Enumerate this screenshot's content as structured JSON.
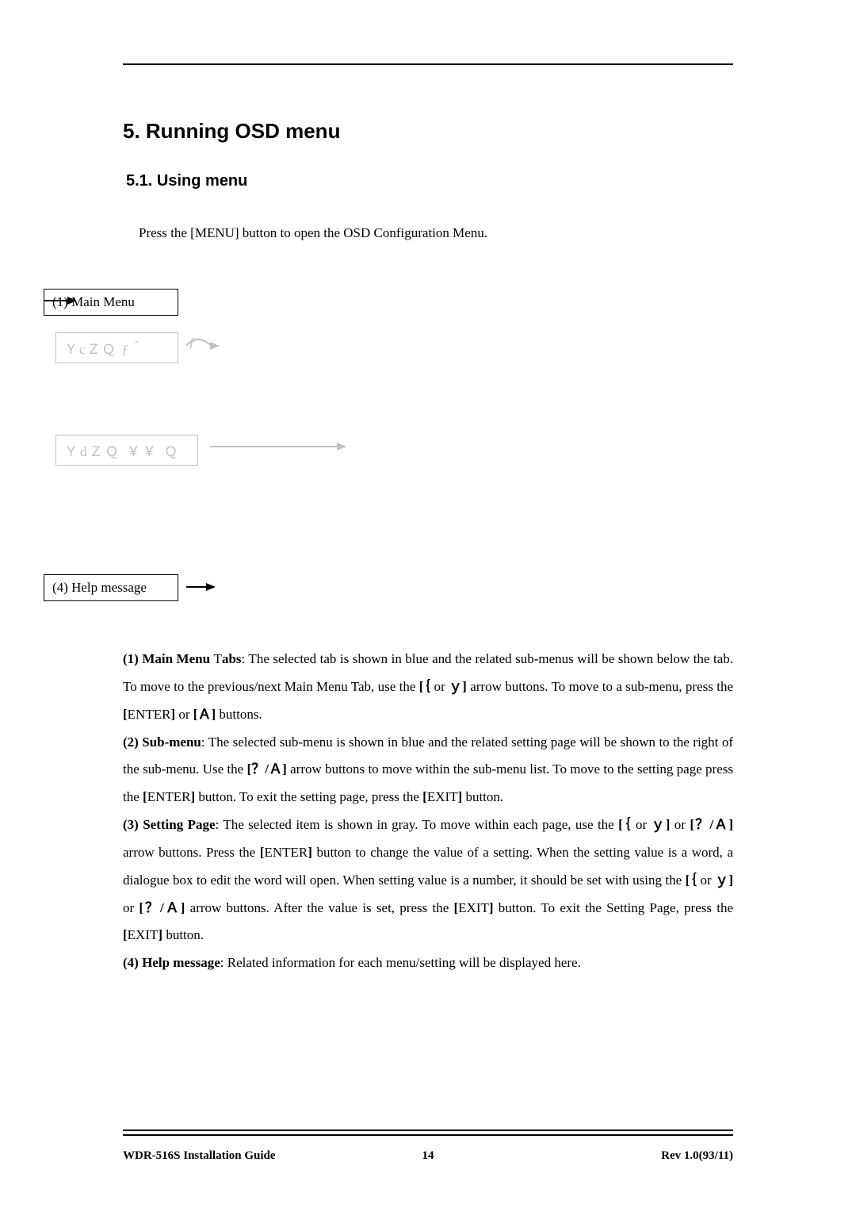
{
  "heading1": "5.  Running OSD menu",
  "heading2": "5.1.  Using menu",
  "intro": "Press the [MENU] button to open the OSD Configuration Menu.",
  "diagram": {
    "box1": "(1) Main Menu",
    "box2": "ＹcＺＱ ƒ＾",
    "box2_curve": "ƒ",
    "box3": "ＹdＺＱ ￥￥ Ｑ",
    "box4": "(4) Help message"
  },
  "paragraphs": [
    [
      {
        "bold": true,
        "text": "(1) Main Menu "
      },
      {
        "bold": false,
        "text": "T"
      },
      {
        "bold": true,
        "text": "abs"
      },
      {
        "bold": false,
        "text": ": The selected tab is shown in blue and the related sub-menus will be shown below the tab. To move to the previous/next Main Menu Tab, use the "
      },
      {
        "bold": true,
        "text": "[｛"
      },
      {
        "bold": false,
        "text": " or "
      },
      {
        "bold": true,
        "text": "ｙ]"
      },
      {
        "bold": false,
        "text": " arrow buttons. To move to a sub-menu, press the "
      },
      {
        "bold": true,
        "text": "["
      },
      {
        "bold": false,
        "text": "ENTER"
      },
      {
        "bold": true,
        "text": "]"
      },
      {
        "bold": false,
        "text": " or "
      },
      {
        "bold": true,
        "text": "[Ａ]"
      },
      {
        "bold": false,
        "text": " buttons."
      }
    ],
    [
      {
        "bold": true,
        "text": "(2) Sub-menu"
      },
      {
        "bold": false,
        "text": ": The selected sub-menu is shown in blue and the related setting page will be shown to the right of the sub-menu. Use the "
      },
      {
        "bold": true,
        "text": "[？/Ａ]"
      },
      {
        "bold": false,
        "text": " arrow buttons to move within the sub-menu list. To move to the setting page press the "
      },
      {
        "bold": true,
        "text": "["
      },
      {
        "bold": false,
        "text": "ENTER"
      },
      {
        "bold": true,
        "text": "]"
      },
      {
        "bold": false,
        "text": " button. To exit the setting page, press the "
      },
      {
        "bold": true,
        "text": "["
      },
      {
        "bold": false,
        "text": "EXIT"
      },
      {
        "bold": true,
        "text": "]"
      },
      {
        "bold": false,
        "text": " button."
      }
    ],
    [
      {
        "bold": true,
        "text": "(3) Setting Page"
      },
      {
        "bold": false,
        "text": ": The selected item is shown in gray. To move within each page, use the "
      },
      {
        "bold": true,
        "text": "[｛"
      },
      {
        "bold": false,
        "text": " or "
      },
      {
        "bold": true,
        "text": "ｙ]"
      },
      {
        "bold": false,
        "text": " or "
      },
      {
        "bold": true,
        "text": "[？/Ａ]"
      },
      {
        "bold": false,
        "text": " arrow buttons. Press the "
      },
      {
        "bold": true,
        "text": "["
      },
      {
        "bold": false,
        "text": "ENTER"
      },
      {
        "bold": true,
        "text": "]"
      },
      {
        "bold": false,
        "text": " button to change the value of a setting. When the setting value is a word, a dialogue box to edit the word will open. When setting value is a number, it should be set with using the "
      },
      {
        "bold": true,
        "text": "[｛"
      },
      {
        "bold": false,
        "text": " or "
      },
      {
        "bold": true,
        "text": "ｙ]"
      },
      {
        "bold": false,
        "text": " or "
      },
      {
        "bold": true,
        "text": "[？/Ａ]"
      },
      {
        "bold": false,
        "text": " arrow buttons. After the value is set, press the "
      },
      {
        "bold": true,
        "text": "["
      },
      {
        "bold": false,
        "text": "EXIT"
      },
      {
        "bold": true,
        "text": "]"
      },
      {
        "bold": false,
        "text": " button. To exit the Setting Page, press the "
      },
      {
        "bold": true,
        "text": "["
      },
      {
        "bold": false,
        "text": "EXIT"
      },
      {
        "bold": true,
        "text": "]"
      },
      {
        "bold": false,
        "text": " button."
      }
    ],
    [
      {
        "bold": true,
        "text": "(4) Help message"
      },
      {
        "bold": false,
        "text": ": Related information for each menu/setting will be displayed here."
      }
    ]
  ],
  "footer": {
    "left": "WDR-516S  Installation  Guide",
    "center": "14",
    "right": "Rev  1.0(93/11)"
  }
}
